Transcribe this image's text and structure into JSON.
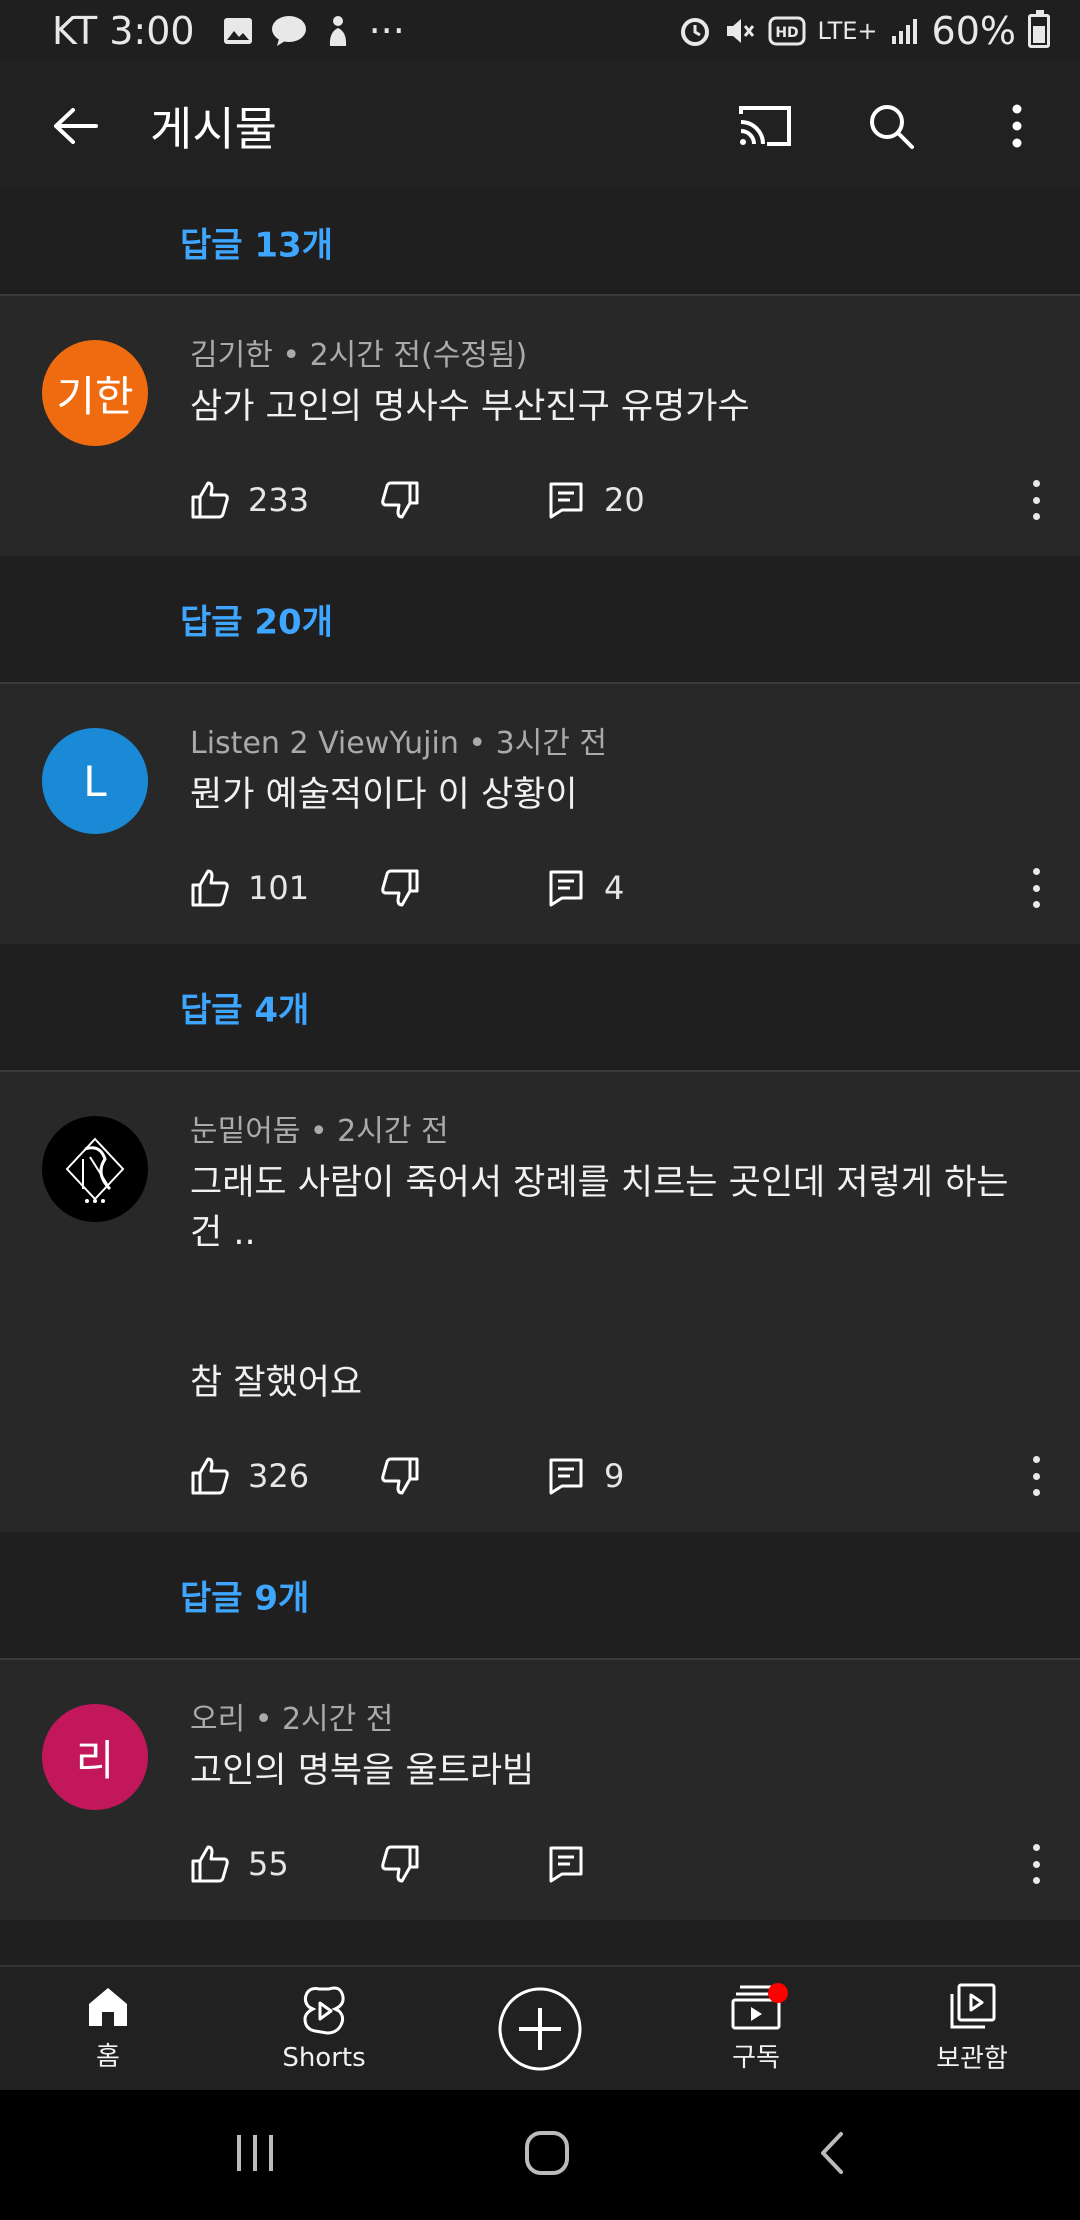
{
  "status_bar": {
    "carrier_time": "KT 3:00",
    "more_indicator": "···",
    "network": "LTE+",
    "battery": "60%"
  },
  "app_bar": {
    "title": "게시물"
  },
  "top_reply": {
    "label": "답글 13개"
  },
  "comments": [
    {
      "avatar_text": "기한",
      "avatar_color": "#ee6b0f",
      "meta": "김기한 • 2시간 전(수정됨)",
      "text": "삼가 고인의 명사수 부산진구 유명가수",
      "likes": "233",
      "reply_count": "20",
      "reply_link": "답글 20개"
    },
    {
      "avatar_text": "L",
      "avatar_color": "#1a8ad6",
      "meta": "Listen 2 ViewYujin • 3시간 전",
      "text": "뭔가 예술적이다 이 상황이",
      "likes": "101",
      "reply_count": "4",
      "reply_link": "답글 4개"
    },
    {
      "avatar_text": "",
      "avatar_color": "#000000",
      "meta": "눈밑어둠 • 2시간 전",
      "text": "그래도 사람이 죽어서 장례를 치르는 곳인데 저렇게 하는 건 ..\n\n\n참 잘했어요",
      "likes": "326",
      "reply_count": "9",
      "reply_link": "답글 9개"
    },
    {
      "avatar_text": "리",
      "avatar_color": "#c2185b",
      "meta": "오리 • 2시간 전",
      "text": "고인의 명복을 울트라빔",
      "likes": "55",
      "reply_count": "",
      "reply_link": ""
    }
  ],
  "bottom_nav": {
    "home": "홈",
    "shorts": "Shorts",
    "subscriptions": "구독",
    "library": "보관함"
  },
  "colors": {
    "link": "#3ea6ff",
    "notification_dot": "#ff0000"
  }
}
